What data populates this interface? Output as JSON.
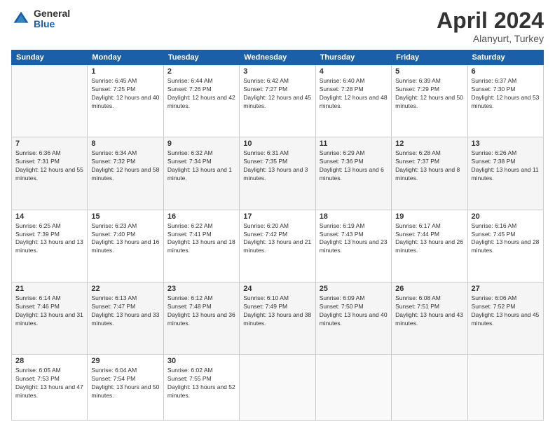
{
  "header": {
    "logo_general": "General",
    "logo_blue": "Blue",
    "title": "April 2024",
    "location": "Alanyurt, Turkey"
  },
  "calendar": {
    "days_of_week": [
      "Sunday",
      "Monday",
      "Tuesday",
      "Wednesday",
      "Thursday",
      "Friday",
      "Saturday"
    ],
    "weeks": [
      [
        {
          "day": "",
          "sunrise": "",
          "sunset": "",
          "daylight": ""
        },
        {
          "day": "1",
          "sunrise": "Sunrise: 6:45 AM",
          "sunset": "Sunset: 7:25 PM",
          "daylight": "Daylight: 12 hours and 40 minutes."
        },
        {
          "day": "2",
          "sunrise": "Sunrise: 6:44 AM",
          "sunset": "Sunset: 7:26 PM",
          "daylight": "Daylight: 12 hours and 42 minutes."
        },
        {
          "day": "3",
          "sunrise": "Sunrise: 6:42 AM",
          "sunset": "Sunset: 7:27 PM",
          "daylight": "Daylight: 12 hours and 45 minutes."
        },
        {
          "day": "4",
          "sunrise": "Sunrise: 6:40 AM",
          "sunset": "Sunset: 7:28 PM",
          "daylight": "Daylight: 12 hours and 48 minutes."
        },
        {
          "day": "5",
          "sunrise": "Sunrise: 6:39 AM",
          "sunset": "Sunset: 7:29 PM",
          "daylight": "Daylight: 12 hours and 50 minutes."
        },
        {
          "day": "6",
          "sunrise": "Sunrise: 6:37 AM",
          "sunset": "Sunset: 7:30 PM",
          "daylight": "Daylight: 12 hours and 53 minutes."
        }
      ],
      [
        {
          "day": "7",
          "sunrise": "Sunrise: 6:36 AM",
          "sunset": "Sunset: 7:31 PM",
          "daylight": "Daylight: 12 hours and 55 minutes."
        },
        {
          "day": "8",
          "sunrise": "Sunrise: 6:34 AM",
          "sunset": "Sunset: 7:32 PM",
          "daylight": "Daylight: 12 hours and 58 minutes."
        },
        {
          "day": "9",
          "sunrise": "Sunrise: 6:32 AM",
          "sunset": "Sunset: 7:34 PM",
          "daylight": "Daylight: 13 hours and 1 minute."
        },
        {
          "day": "10",
          "sunrise": "Sunrise: 6:31 AM",
          "sunset": "Sunset: 7:35 PM",
          "daylight": "Daylight: 13 hours and 3 minutes."
        },
        {
          "day": "11",
          "sunrise": "Sunrise: 6:29 AM",
          "sunset": "Sunset: 7:36 PM",
          "daylight": "Daylight: 13 hours and 6 minutes."
        },
        {
          "day": "12",
          "sunrise": "Sunrise: 6:28 AM",
          "sunset": "Sunset: 7:37 PM",
          "daylight": "Daylight: 13 hours and 8 minutes."
        },
        {
          "day": "13",
          "sunrise": "Sunrise: 6:26 AM",
          "sunset": "Sunset: 7:38 PM",
          "daylight": "Daylight: 13 hours and 11 minutes."
        }
      ],
      [
        {
          "day": "14",
          "sunrise": "Sunrise: 6:25 AM",
          "sunset": "Sunset: 7:39 PM",
          "daylight": "Daylight: 13 hours and 13 minutes."
        },
        {
          "day": "15",
          "sunrise": "Sunrise: 6:23 AM",
          "sunset": "Sunset: 7:40 PM",
          "daylight": "Daylight: 13 hours and 16 minutes."
        },
        {
          "day": "16",
          "sunrise": "Sunrise: 6:22 AM",
          "sunset": "Sunset: 7:41 PM",
          "daylight": "Daylight: 13 hours and 18 minutes."
        },
        {
          "day": "17",
          "sunrise": "Sunrise: 6:20 AM",
          "sunset": "Sunset: 7:42 PM",
          "daylight": "Daylight: 13 hours and 21 minutes."
        },
        {
          "day": "18",
          "sunrise": "Sunrise: 6:19 AM",
          "sunset": "Sunset: 7:43 PM",
          "daylight": "Daylight: 13 hours and 23 minutes."
        },
        {
          "day": "19",
          "sunrise": "Sunrise: 6:17 AM",
          "sunset": "Sunset: 7:44 PM",
          "daylight": "Daylight: 13 hours and 26 minutes."
        },
        {
          "day": "20",
          "sunrise": "Sunrise: 6:16 AM",
          "sunset": "Sunset: 7:45 PM",
          "daylight": "Daylight: 13 hours and 28 minutes."
        }
      ],
      [
        {
          "day": "21",
          "sunrise": "Sunrise: 6:14 AM",
          "sunset": "Sunset: 7:46 PM",
          "daylight": "Daylight: 13 hours and 31 minutes."
        },
        {
          "day": "22",
          "sunrise": "Sunrise: 6:13 AM",
          "sunset": "Sunset: 7:47 PM",
          "daylight": "Daylight: 13 hours and 33 minutes."
        },
        {
          "day": "23",
          "sunrise": "Sunrise: 6:12 AM",
          "sunset": "Sunset: 7:48 PM",
          "daylight": "Daylight: 13 hours and 36 minutes."
        },
        {
          "day": "24",
          "sunrise": "Sunrise: 6:10 AM",
          "sunset": "Sunset: 7:49 PM",
          "daylight": "Daylight: 13 hours and 38 minutes."
        },
        {
          "day": "25",
          "sunrise": "Sunrise: 6:09 AM",
          "sunset": "Sunset: 7:50 PM",
          "daylight": "Daylight: 13 hours and 40 minutes."
        },
        {
          "day": "26",
          "sunrise": "Sunrise: 6:08 AM",
          "sunset": "Sunset: 7:51 PM",
          "daylight": "Daylight: 13 hours and 43 minutes."
        },
        {
          "day": "27",
          "sunrise": "Sunrise: 6:06 AM",
          "sunset": "Sunset: 7:52 PM",
          "daylight": "Daylight: 13 hours and 45 minutes."
        }
      ],
      [
        {
          "day": "28",
          "sunrise": "Sunrise: 6:05 AM",
          "sunset": "Sunset: 7:53 PM",
          "daylight": "Daylight: 13 hours and 47 minutes."
        },
        {
          "day": "29",
          "sunrise": "Sunrise: 6:04 AM",
          "sunset": "Sunset: 7:54 PM",
          "daylight": "Daylight: 13 hours and 50 minutes."
        },
        {
          "day": "30",
          "sunrise": "Sunrise: 6:02 AM",
          "sunset": "Sunset: 7:55 PM",
          "daylight": "Daylight: 13 hours and 52 minutes."
        },
        {
          "day": "",
          "sunrise": "",
          "sunset": "",
          "daylight": ""
        },
        {
          "day": "",
          "sunrise": "",
          "sunset": "",
          "daylight": ""
        },
        {
          "day": "",
          "sunrise": "",
          "sunset": "",
          "daylight": ""
        },
        {
          "day": "",
          "sunrise": "",
          "sunset": "",
          "daylight": ""
        }
      ]
    ]
  }
}
